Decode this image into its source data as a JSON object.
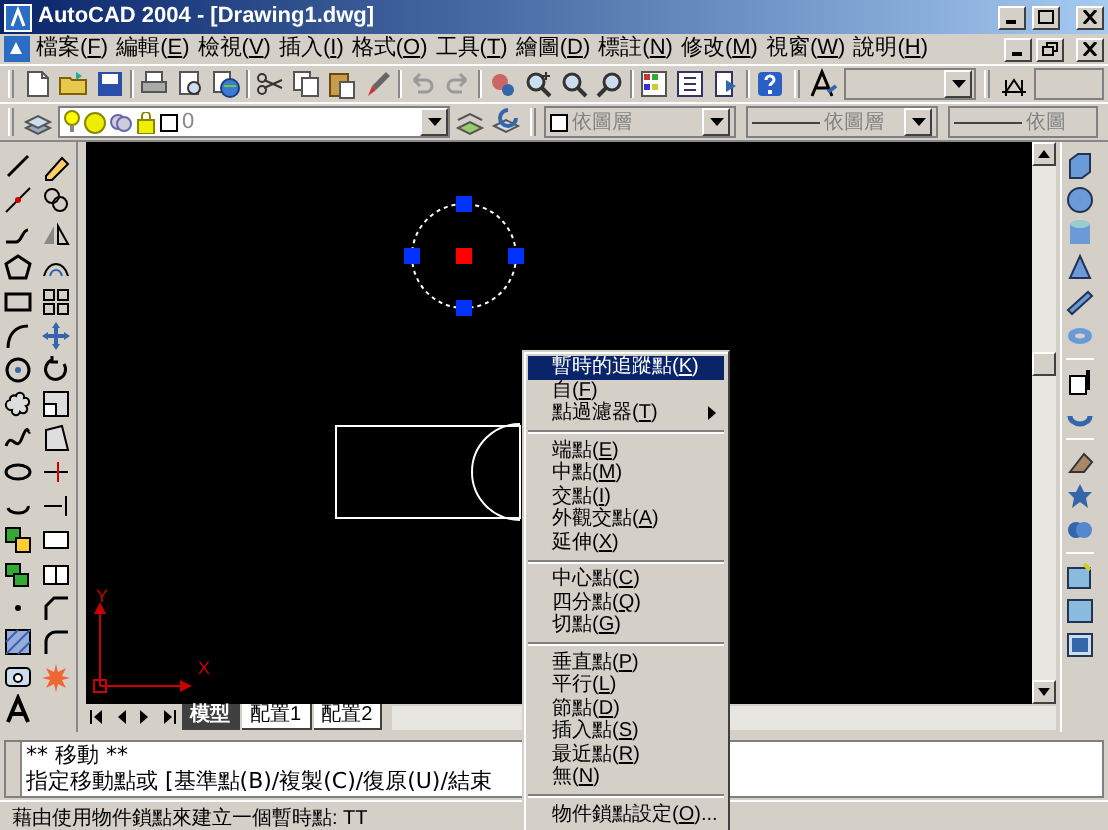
{
  "window": {
    "title": "AutoCAD 2004 - [Drawing1.dwg]"
  },
  "menu_bar": [
    "檔案(F)",
    "編輯(E)",
    "檢視(V)",
    "插入(I)",
    "格式(O)",
    "工具(T)",
    "繪圖(D)",
    "標註(N)",
    "修改(M)",
    "視窗(W)",
    "說明(H)"
  ],
  "layer_combo": {
    "value": "0"
  },
  "property_combos": [
    {
      "value": "依圖層",
      "kind": "color"
    },
    {
      "value": "依圖層",
      "kind": "line"
    },
    {
      "value": "依圖",
      "kind": "line"
    }
  ],
  "canvas": {
    "ucs": {
      "x_label": "X",
      "y_label": "Y"
    }
  },
  "layout_tabs": [
    {
      "label": "模型",
      "selected": true
    },
    {
      "label": "配置1",
      "selected": false
    },
    {
      "label": "配置2",
      "selected": false
    }
  ],
  "command_lines": [
    "** 移動 **",
    "指定移動點或 [基準點(B)/複製(C)/復原(U)/結束"
  ],
  "status_bar": {
    "text": "藉由使用物件鎖點來建立一個暫時點: TT"
  },
  "context_menu": {
    "groups": [
      [
        {
          "label": "暫時的追蹤點(K)",
          "selected": true,
          "submenu": false
        },
        {
          "label": "自(F)",
          "selected": false,
          "submenu": false
        },
        {
          "label": "點過濾器(T)",
          "selected": false,
          "submenu": true
        }
      ],
      [
        {
          "label": "端點(E)",
          "selected": false,
          "submenu": false
        },
        {
          "label": "中點(M)",
          "selected": false,
          "submenu": false
        },
        {
          "label": "交點(I)",
          "selected": false,
          "submenu": false
        },
        {
          "label": "外觀交點(A)",
          "selected": false,
          "submenu": false
        },
        {
          "label": "延伸(X)",
          "selected": false,
          "submenu": false
        }
      ],
      [
        {
          "label": "中心點(C)",
          "selected": false,
          "submenu": false
        },
        {
          "label": "四分點(Q)",
          "selected": false,
          "submenu": false
        },
        {
          "label": "切點(G)",
          "selected": false,
          "submenu": false
        }
      ],
      [
        {
          "label": "垂直點(P)",
          "selected": false,
          "submenu": false
        },
        {
          "label": "平行(L)",
          "selected": false,
          "submenu": false
        },
        {
          "label": "節點(D)",
          "selected": false,
          "submenu": false
        },
        {
          "label": "插入點(S)",
          "selected": false,
          "submenu": false
        },
        {
          "label": "最近點(R)",
          "selected": false,
          "submenu": false
        },
        {
          "label": "無(N)",
          "selected": false,
          "submenu": false
        }
      ],
      [
        {
          "label": "物件鎖點設定(O)...",
          "selected": false,
          "submenu": false
        }
      ]
    ]
  }
}
